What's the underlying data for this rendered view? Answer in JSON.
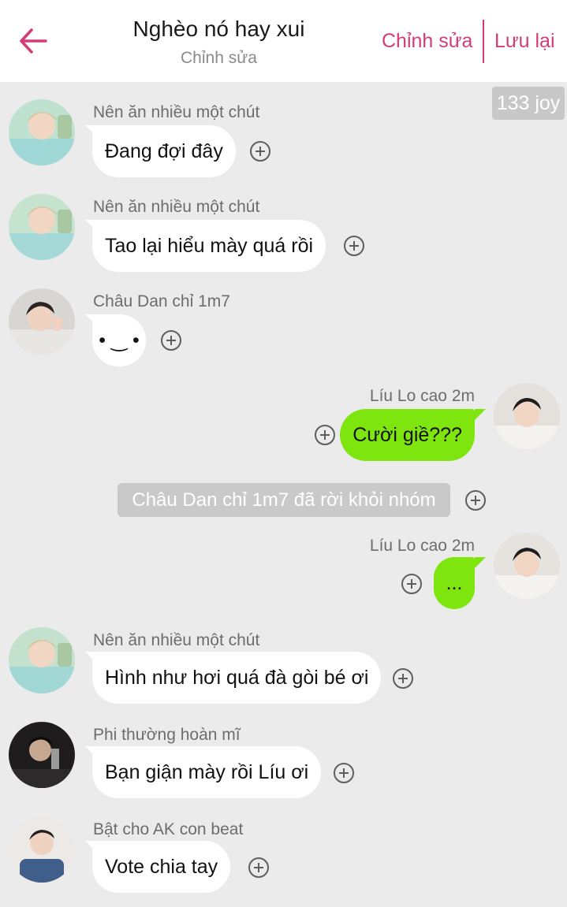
{
  "header": {
    "title": "Nghèo nó hay xui",
    "subtitle": "Chỉnh sửa",
    "edit_label": "Chỉnh sửa",
    "save_label": "Lưu lại",
    "accent_color": "#d33b79"
  },
  "badge": {
    "text": "133 joy"
  },
  "messages": [
    {
      "sender": "Nên ăn nhiều một chút",
      "text": "Đang đợi đây",
      "side": "in"
    },
    {
      "sender": "Nên ăn nhiều một chút",
      "text": "Tao lại hiểu mày quá rồi",
      "side": "in"
    },
    {
      "sender": "Châu Dan chỉ 1m7",
      "text": "• ‿ •",
      "side": "in"
    },
    {
      "sender": "Líu Lo cao 2m",
      "text": "Cười giề???",
      "side": "out"
    },
    {
      "sender": "Líu Lo cao 2m",
      "text": "...",
      "side": "out"
    },
    {
      "sender": "Nên ăn nhiều một chút",
      "text": "Hình như hơi quá đà gòi bé ơi",
      "side": "in"
    },
    {
      "sender": "Phi thường hoàn mĩ",
      "text": "Bạn giận mày rồi Líu ơi",
      "side": "in"
    },
    {
      "sender": "Bật cho AK con beat",
      "text": "Vote chia tay",
      "side": "in"
    }
  ],
  "system_notice": "Châu Dan chỉ 1m7 đã rời khỏi nhóm",
  "colors": {
    "background": "#ebebeb",
    "outgoing_bubble": "#7ee60e",
    "incoming_bubble": "#ffffff"
  },
  "icons": [
    "back-arrow-icon",
    "add-reaction-icon"
  ]
}
